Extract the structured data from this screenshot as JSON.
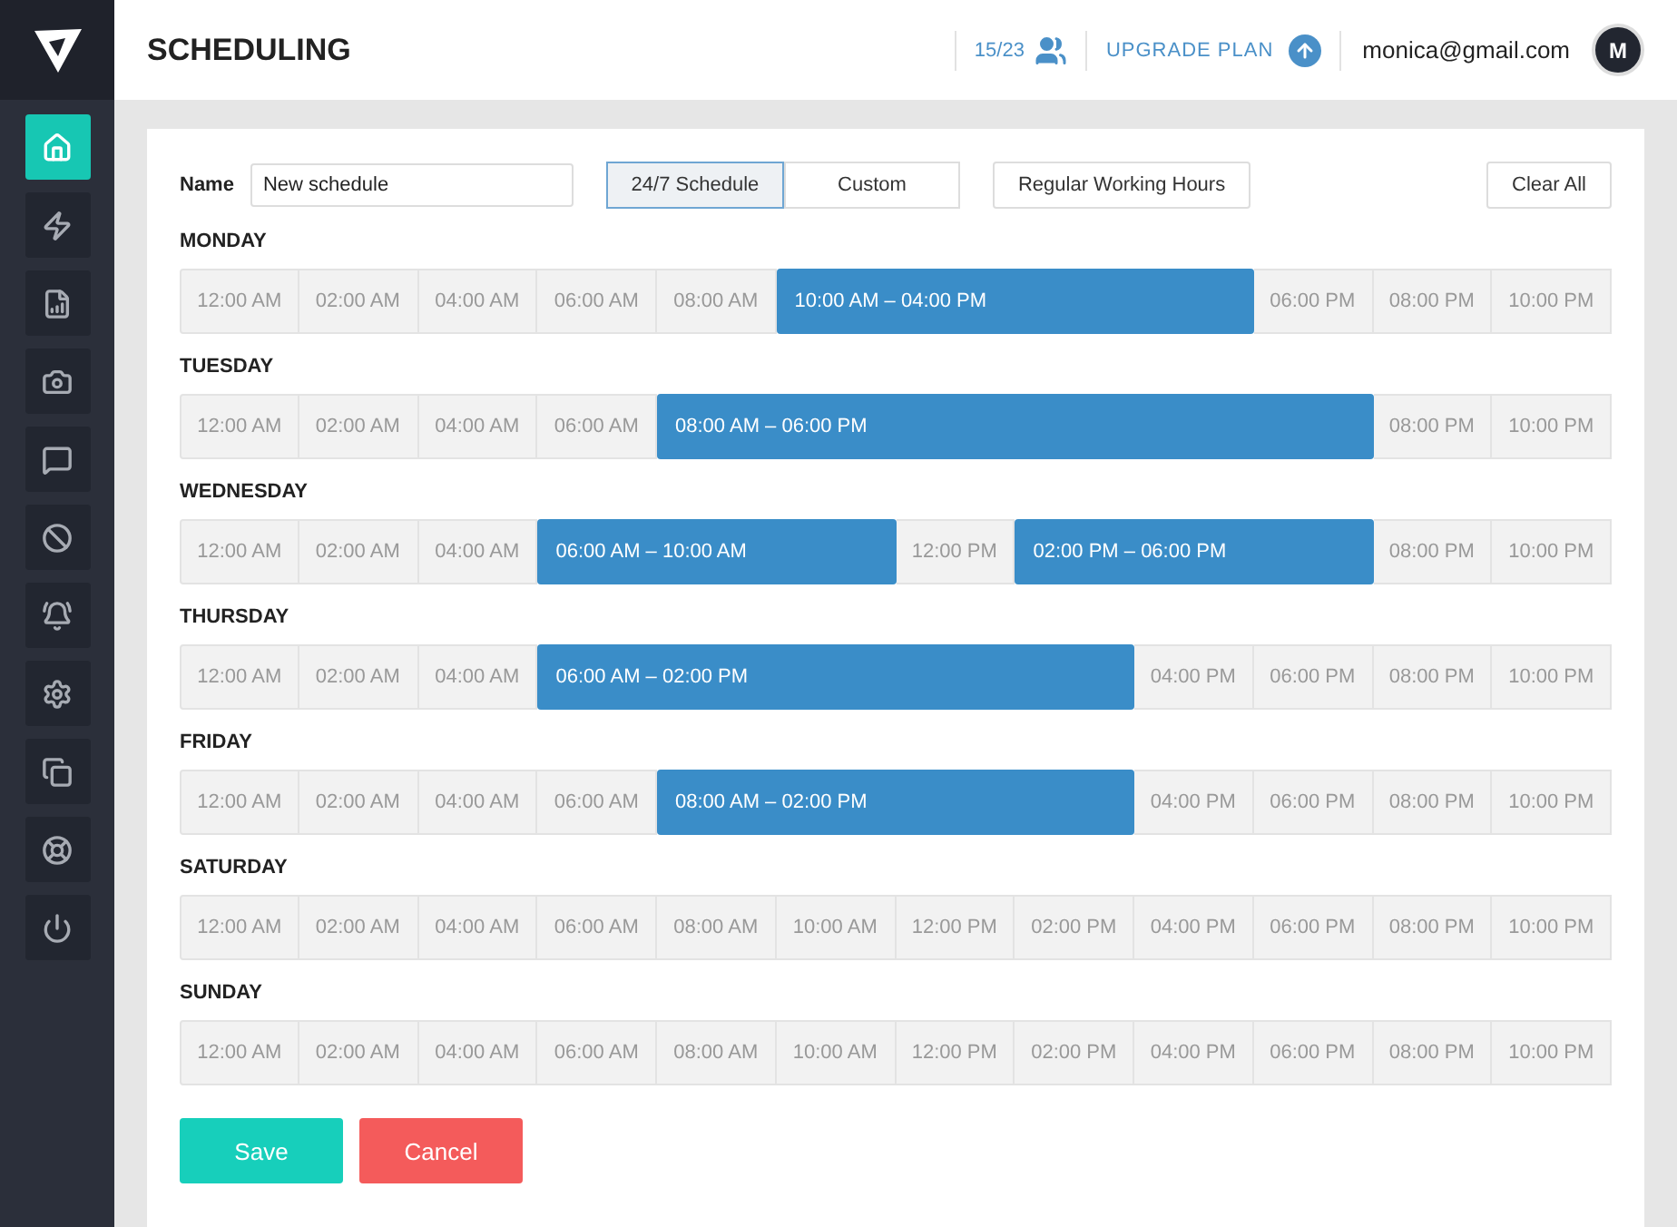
{
  "header": {
    "title": "SCHEDULING",
    "seats": "15/23",
    "upgrade": "UPGRADE PLAN",
    "email": "monica@gmail.com",
    "avatar": "M"
  },
  "sidebar": {
    "items": [
      {
        "selected": true
      },
      {
        "selected": false
      },
      {
        "selected": false
      },
      {
        "selected": false
      },
      {
        "selected": false
      },
      {
        "selected": false
      },
      {
        "selected": false
      },
      {
        "selected": false
      },
      {
        "selected": false
      },
      {
        "selected": false
      },
      {
        "selected": false
      }
    ]
  },
  "form": {
    "name_label": "Name",
    "name_value": "New schedule",
    "modes": [
      {
        "label": "24/7 Schedule",
        "selected": true
      },
      {
        "label": "Custom",
        "selected": false
      }
    ],
    "preset": "Regular Working Hours",
    "clear": "Clear All"
  },
  "days": [
    {
      "name": "MONDAY",
      "cells": [
        {
          "label": "12:00 AM",
          "selected": false
        },
        {
          "label": "02:00 AM",
          "selected": false
        },
        {
          "label": "04:00 AM",
          "selected": false
        },
        {
          "label": "06:00 AM",
          "selected": false
        },
        {
          "label": "08:00 AM",
          "selected": false
        },
        {
          "label": "10:00 AM – 04:00 PM",
          "selected": true
        },
        {
          "selected": true
        },
        {
          "selected": true
        },
        {
          "selected": true
        },
        {
          "label": "06:00 PM",
          "selected": false
        },
        {
          "label": "08:00 PM",
          "selected": false
        },
        {
          "label": "10:00 PM",
          "selected": false
        }
      ]
    },
    {
      "name": "TUESDAY",
      "cells": [
        {
          "label": "12:00 AM",
          "selected": false
        },
        {
          "label": "02:00 AM",
          "selected": false
        },
        {
          "label": "04:00 AM",
          "selected": false
        },
        {
          "label": "06:00 AM",
          "selected": false
        },
        {
          "label": "08:00 AM – 06:00 PM",
          "selected": true
        },
        {
          "selected": true
        },
        {
          "selected": true
        },
        {
          "selected": true
        },
        {
          "selected": true
        },
        {
          "selected": true
        },
        {
          "label": "08:00 PM",
          "selected": false
        },
        {
          "label": "10:00 PM",
          "selected": false
        }
      ]
    },
    {
      "name": "WEDNESDAY",
      "cells": [
        {
          "label": "12:00 AM",
          "selected": false
        },
        {
          "label": "02:00 AM",
          "selected": false
        },
        {
          "label": "04:00 AM",
          "selected": false
        },
        {
          "label": "06:00 AM – 10:00 AM",
          "selected": true
        },
        {
          "selected": true
        },
        {
          "selected": true
        },
        {
          "label": "12:00 PM",
          "selected": false
        },
        {
          "label": "02:00 PM – 06:00 PM",
          "selected": true
        },
        {
          "selected": true
        },
        {
          "selected": true
        },
        {
          "label": "08:00 PM",
          "selected": false
        },
        {
          "label": "10:00 PM",
          "selected": false
        }
      ]
    },
    {
      "name": "THURSDAY",
      "cells": [
        {
          "label": "12:00 AM",
          "selected": false
        },
        {
          "label": "02:00 AM",
          "selected": false
        },
        {
          "label": "04:00 AM",
          "selected": false
        },
        {
          "label": "06:00 AM – 02:00 PM",
          "selected": true
        },
        {
          "selected": true
        },
        {
          "selected": true
        },
        {
          "selected": true
        },
        {
          "selected": true
        },
        {
          "label": "04:00 PM",
          "selected": false
        },
        {
          "label": "06:00 PM",
          "selected": false
        },
        {
          "label": "08:00 PM",
          "selected": false
        },
        {
          "label": "10:00 PM",
          "selected": false
        }
      ]
    },
    {
      "name": "FRIDAY",
      "cells": [
        {
          "label": "12:00 AM",
          "selected": false
        },
        {
          "label": "02:00 AM",
          "selected": false
        },
        {
          "label": "04:00 AM",
          "selected": false
        },
        {
          "label": "06:00 AM",
          "selected": false
        },
        {
          "label": "08:00 AM – 02:00 PM",
          "selected": true
        },
        {
          "selected": true
        },
        {
          "selected": true
        },
        {
          "selected": true
        },
        {
          "label": "04:00 PM",
          "selected": false
        },
        {
          "label": "06:00 PM",
          "selected": false
        },
        {
          "label": "08:00 PM",
          "selected": false
        },
        {
          "label": "10:00 PM",
          "selected": false
        }
      ]
    },
    {
      "name": "SATURDAY",
      "cells": [
        {
          "label": "12:00 AM",
          "selected": false
        },
        {
          "label": "02:00 AM",
          "selected": false
        },
        {
          "label": "04:00 AM",
          "selected": false
        },
        {
          "label": "06:00 AM",
          "selected": false
        },
        {
          "label": "08:00 AM",
          "selected": false
        },
        {
          "label": "10:00 AM",
          "selected": false
        },
        {
          "label": "12:00 PM",
          "selected": false
        },
        {
          "label": "02:00 PM",
          "selected": false
        },
        {
          "label": "04:00 PM",
          "selected": false
        },
        {
          "label": "06:00 PM",
          "selected": false
        },
        {
          "label": "08:00 PM",
          "selected": false
        },
        {
          "label": "10:00 PM",
          "selected": false
        }
      ]
    },
    {
      "name": "SUNDAY",
      "cells": [
        {
          "label": "12:00 AM",
          "selected": false
        },
        {
          "label": "02:00 AM",
          "selected": false
        },
        {
          "label": "04:00 AM",
          "selected": false
        },
        {
          "label": "06:00 AM",
          "selected": false
        },
        {
          "label": "08:00 AM",
          "selected": false
        },
        {
          "label": "10:00 AM",
          "selected": false
        },
        {
          "label": "12:00 PM",
          "selected": false
        },
        {
          "label": "02:00 PM",
          "selected": false
        },
        {
          "label": "04:00 PM",
          "selected": false
        },
        {
          "label": "06:00 PM",
          "selected": false
        },
        {
          "label": "08:00 PM",
          "selected": false
        },
        {
          "label": "10:00 PM",
          "selected": false
        }
      ]
    }
  ],
  "actions": {
    "save": "Save",
    "cancel": "Cancel"
  }
}
